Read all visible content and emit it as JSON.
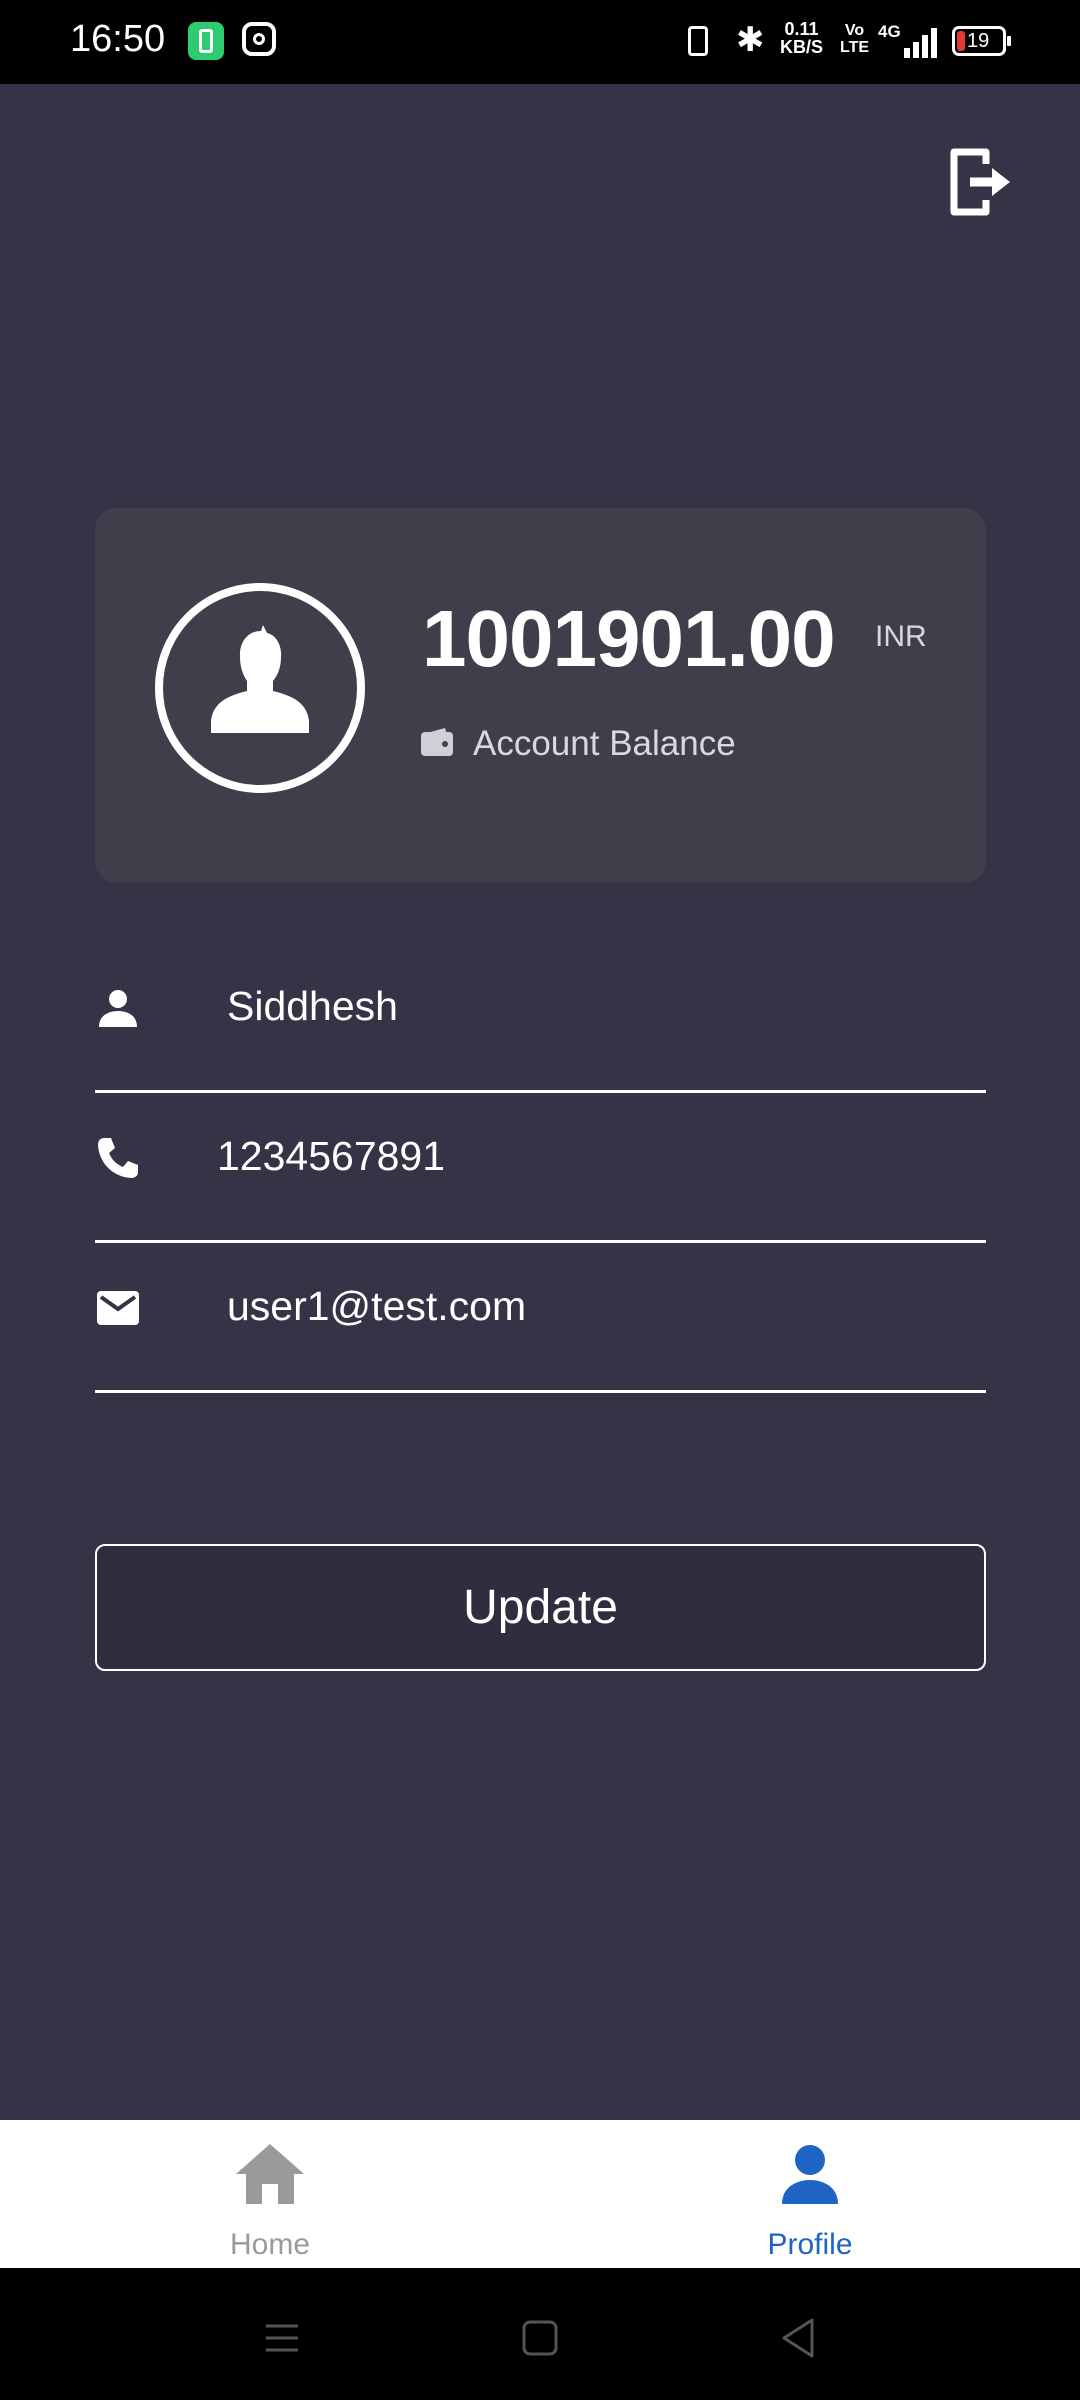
{
  "status_bar": {
    "time": "16:50",
    "net_speed_value": "0.11",
    "net_speed_unit": "KB/S",
    "volte_top": "Vo",
    "volte_bottom": "LTE",
    "network_type": "4G",
    "battery_level": "19",
    "icons": [
      "battery-saver-app-icon",
      "instagram-icon",
      "vibrate-icon",
      "bluetooth-icon",
      "signal-icon",
      "battery-icon"
    ]
  },
  "header": {
    "logout_icon": "logout-icon"
  },
  "balance_card": {
    "amount": "1001901.00",
    "currency": "INR",
    "label": "Account Balance",
    "avatar_icon": "user-avatar-icon",
    "wallet_icon": "wallet-icon"
  },
  "profile_fields": {
    "name": {
      "value": "Siddhesh",
      "icon": "person-icon"
    },
    "phone": {
      "value": "1234567891",
      "icon": "phone-icon"
    },
    "email": {
      "value": "user1@test.com",
      "icon": "mail-icon"
    }
  },
  "update_button": {
    "label": "Update"
  },
  "bottom_nav": {
    "items": [
      {
        "label": "Home",
        "icon": "home-icon",
        "active": false
      },
      {
        "label": "Profile",
        "icon": "person-icon",
        "active": true
      }
    ],
    "active_color": "#1f63c5",
    "inactive_color": "#9a9a9a"
  },
  "system_nav": {
    "icons": [
      "menu-icon",
      "home-square-icon",
      "back-icon"
    ]
  },
  "colors": {
    "background": "#363346",
    "card": "#3f3f4b",
    "button": "#302d3f"
  }
}
